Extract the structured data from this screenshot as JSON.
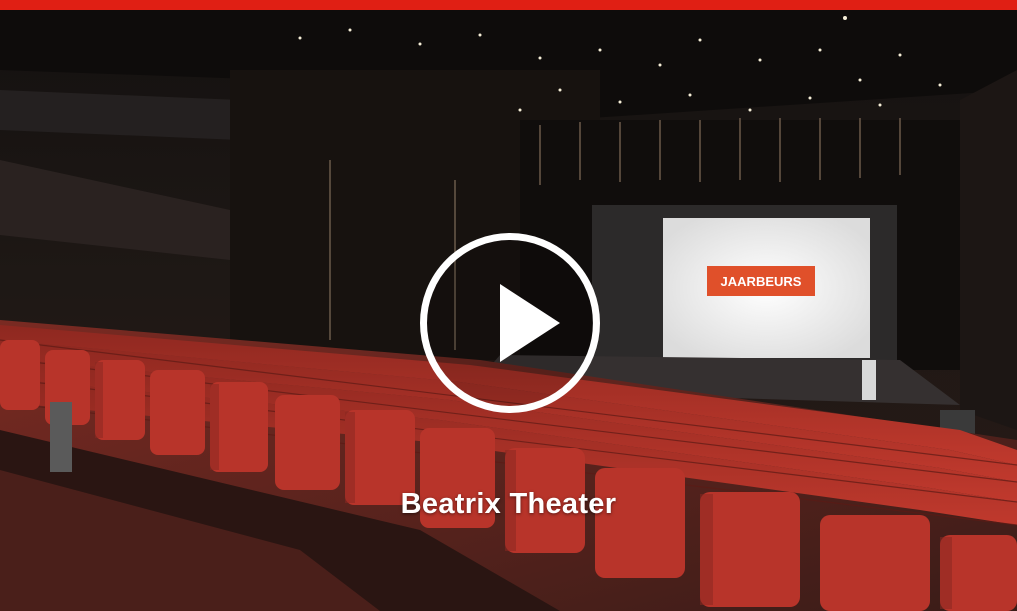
{
  "video": {
    "title": "Beatrix Theater",
    "play_label": "Play video"
  },
  "screen_sign": {
    "logo_text": "JAARBEURS"
  },
  "colors": {
    "accent_bar": "#e01f14",
    "seat_red": "#b8342a",
    "text": "#ffffff"
  },
  "icons": [
    "play-icon"
  ]
}
